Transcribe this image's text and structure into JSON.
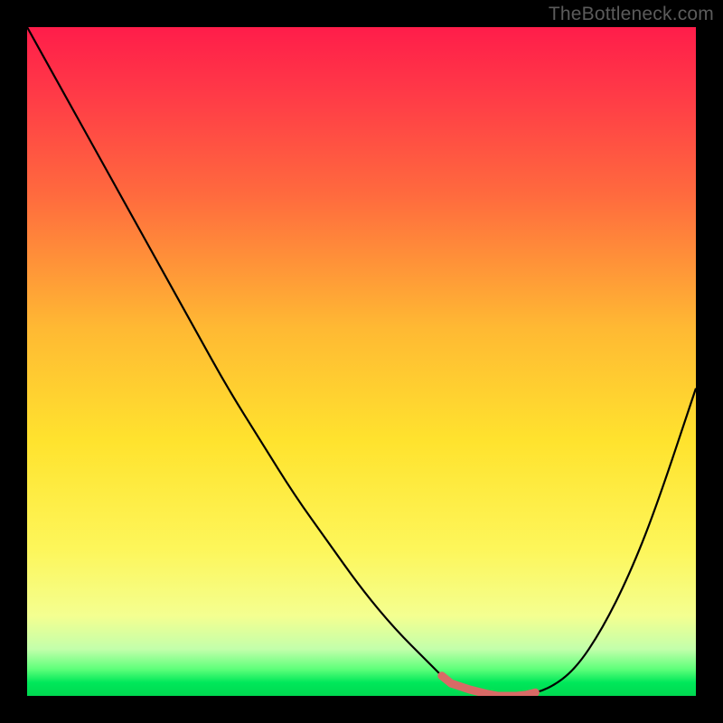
{
  "watermark": "TheBottleneck.com",
  "chart_data": {
    "type": "line",
    "title": "",
    "xlabel": "",
    "ylabel": "",
    "xlim": [
      0,
      100
    ],
    "ylim": [
      0,
      100
    ],
    "x": [
      0,
      5,
      10,
      15,
      20,
      25,
      30,
      35,
      40,
      45,
      50,
      55,
      60,
      63,
      66,
      70,
      74,
      78,
      82,
      86,
      90,
      94,
      100
    ],
    "values": [
      100,
      91,
      82,
      73,
      64,
      55,
      46,
      38,
      30,
      23,
      16,
      10,
      5,
      2,
      1,
      0,
      0,
      1,
      4,
      10,
      18,
      28,
      46
    ],
    "series_style": {
      "color": "#000000",
      "width": 2
    },
    "marker_segment": {
      "x_range": [
        62,
        76
      ],
      "color": "#d86a66",
      "width": 7
    },
    "background": {
      "type": "vertical-gradient",
      "stops": [
        {
          "pos": 0.0,
          "color": "#ff1d4a"
        },
        {
          "pos": 0.25,
          "color": "#ff6a3e"
        },
        {
          "pos": 0.45,
          "color": "#ffb933"
        },
        {
          "pos": 0.62,
          "color": "#ffe32e"
        },
        {
          "pos": 0.88,
          "color": "#f4ff90"
        },
        {
          "pos": 0.96,
          "color": "#5eff7a"
        },
        {
          "pos": 1.0,
          "color": "#00d850"
        }
      ]
    }
  }
}
